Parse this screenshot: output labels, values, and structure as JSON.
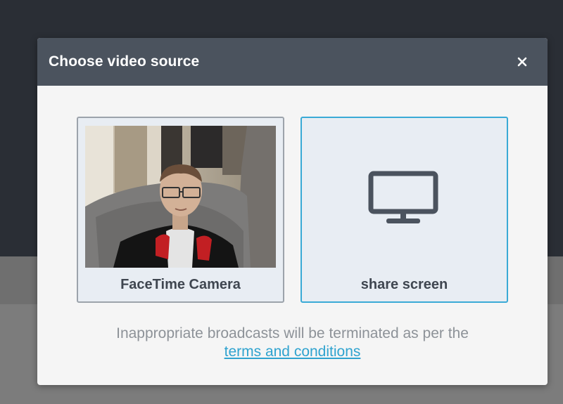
{
  "modal": {
    "title": "Choose video source",
    "close_icon": "close-icon"
  },
  "sources": {
    "camera_label": "FaceTime Camera",
    "screen_label": "share screen",
    "screen_icon": "monitor-icon"
  },
  "notice": {
    "text": "Inappropriate broadcasts will be terminated as per the",
    "link_text": "terms and conditions"
  },
  "colors": {
    "header_bg": "#4b535e",
    "accent": "#3aaad6",
    "link": "#2fa3cf",
    "backdrop": "#2a2e35"
  }
}
